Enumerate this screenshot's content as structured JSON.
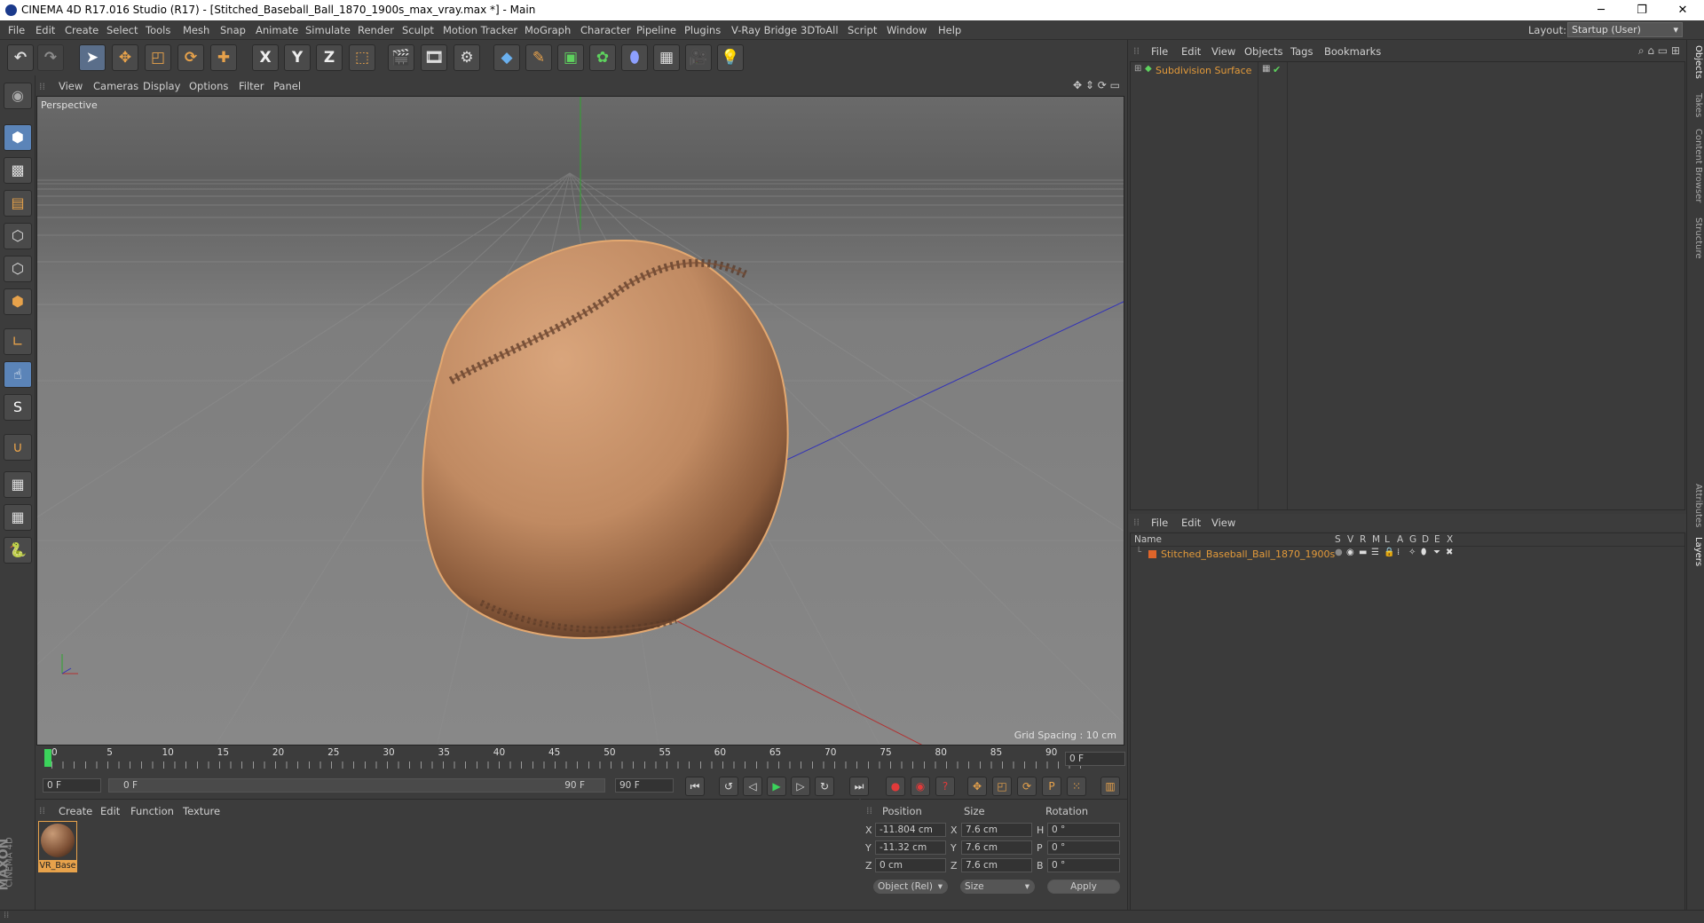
{
  "window": {
    "title": "CINEMA 4D R17.016 Studio (R17) - [Stitched_Baseball_Ball_1870_1900s_max_vray.max *] - Main",
    "buttons": {
      "minimize": "─",
      "restore": "❐",
      "close": "✕"
    }
  },
  "menubar": {
    "items": [
      "File",
      "Edit",
      "Create",
      "Select",
      "Tools",
      "Mesh",
      "Snap",
      "Animate",
      "Simulate",
      "Render",
      "Sculpt",
      "Motion Tracker",
      "MoGraph",
      "Character",
      "Pipeline",
      "Plugins",
      "V-Ray Bridge",
      "3DToAll",
      "Script",
      "Window",
      "Help"
    ],
    "layout_label": "Layout:",
    "layout_value": "Startup (User)"
  },
  "toolbar": {
    "icons": [
      "undo-icon",
      "redo-icon",
      "select-icon",
      "move-icon",
      "scale-icon",
      "rotate-icon",
      "last-tool-icon",
      "x-axis-icon",
      "y-axis-icon",
      "z-axis-icon",
      "coordinate-system-icon",
      "render-view-icon",
      "render-picture-viewer-icon",
      "render-settings-icon",
      "cube-icon",
      "pen-icon",
      "subdivision-icon",
      "array-icon",
      "deformer-icon",
      "floor-icon",
      "camera-icon",
      "light-icon"
    ],
    "axis_labels": [
      "X",
      "Y",
      "Z"
    ]
  },
  "leftbar": {
    "icons": [
      "make-editable-icon",
      "model-mode-icon",
      "texture-mode-icon",
      "workplane-icon",
      "points-mode-icon",
      "edges-mode-icon",
      "polygons-mode-icon",
      "axis-icon",
      "tweak-icon",
      "snap-icon",
      "magnet-icon",
      "lock-icon",
      "paint-icon",
      "python-icon"
    ],
    "snap_glyph": "S"
  },
  "viewport": {
    "menu": [
      "View",
      "Cameras",
      "Display",
      "Options",
      "Filter",
      "Panel"
    ],
    "label": "Perspective",
    "grid_spacing": "Grid Spacing : 10 cm"
  },
  "timeline": {
    "ticks": [
      "0",
      "5",
      "10",
      "15",
      "20",
      "25",
      "30",
      "35",
      "40",
      "45",
      "50",
      "55",
      "60",
      "65",
      "70",
      "75",
      "80",
      "85",
      "90"
    ],
    "current_frame": "0 F",
    "playhead_fraction": 0.0
  },
  "transport": {
    "start_field": "0 F",
    "range_start": "0 F",
    "range_end": "90 F",
    "end_field": "90 F",
    "record_key_glyph": "?",
    "param_key_glyph": "P"
  },
  "material_manager": {
    "menu": [
      "Create",
      "Edit",
      "Function",
      "Texture"
    ],
    "materials": [
      {
        "name": "VR_Base"
      }
    ],
    "brand": "MAXON",
    "brand_product": "CINEMA 4D"
  },
  "coordinates": {
    "headers": [
      "Position",
      "Size",
      "Rotation"
    ],
    "rows": [
      {
        "axis": "X",
        "pos": "-11.804 cm",
        "size_axis": "X",
        "size": "7.6 cm",
        "rot_axis": "H",
        "rot": "0 °"
      },
      {
        "axis": "Y",
        "pos": "-11.32 cm",
        "size_axis": "Y",
        "size": "7.6 cm",
        "rot_axis": "P",
        "rot": "0 °"
      },
      {
        "axis": "Z",
        "pos": "0 cm",
        "size_axis": "Z",
        "size": "7.6 cm",
        "rot_axis": "B",
        "rot": "0 °"
      }
    ],
    "mode_select": "Object (Rel)",
    "size_select": "Size",
    "apply": "Apply"
  },
  "object_manager": {
    "menu": [
      "File",
      "Edit",
      "View",
      "Objects",
      "Tags",
      "Bookmarks"
    ],
    "objects": [
      {
        "name": "Subdivision Surface"
      }
    ]
  },
  "layer_manager": {
    "menu": [
      "File",
      "Edit",
      "View"
    ],
    "columns": [
      "Name",
      "S",
      "V",
      "R",
      "M",
      "L",
      "A",
      "G",
      "D",
      "E",
      "X"
    ],
    "layers": [
      {
        "name": "Stitched_Baseball_Ball_1870_1900s"
      }
    ]
  },
  "side_tabs": [
    "Objects",
    "Takes",
    "Content Browser",
    "Structure",
    "Attributes",
    "Layers"
  ],
  "colors": {
    "accent_orange": "#e7a24b",
    "object_name": "#e39a3a",
    "selected_blue": "#5b84b8",
    "play_green": "#3bd35b",
    "axis_x": "#b23232",
    "axis_y": "#2fa52f",
    "axis_z": "#3232b8"
  }
}
